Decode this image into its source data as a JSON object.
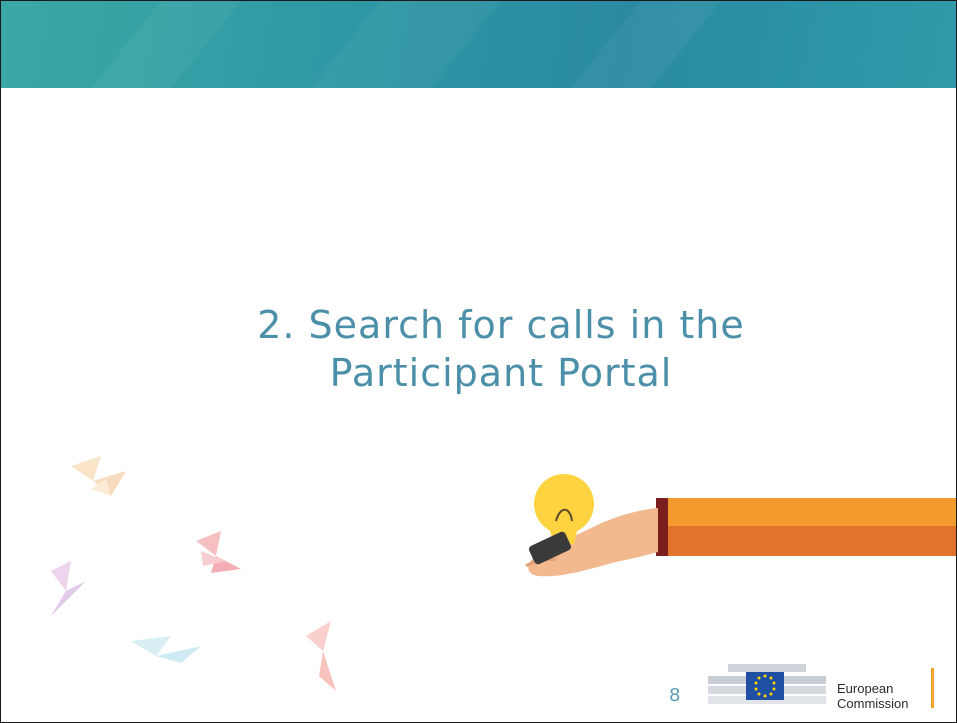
{
  "slide": {
    "title_line1": "2. Search for calls in the",
    "title_line2": "Participant Portal",
    "page_number": "8"
  },
  "logo": {
    "name_line1": "European",
    "name_line2": "Commission"
  },
  "colors": {
    "banner": "#2f98a4",
    "title": "#4b8fa8",
    "sleeve_orange": "#f29a2e",
    "ec_accent": "#f4a229",
    "eu_flag_blue": "#1f4fa0",
    "eu_stars": "#ffd400"
  },
  "icons": [
    "paper-bird-icon",
    "lightbulb-icon",
    "hand-icon",
    "eu-flag-icon",
    "building-icon"
  ]
}
